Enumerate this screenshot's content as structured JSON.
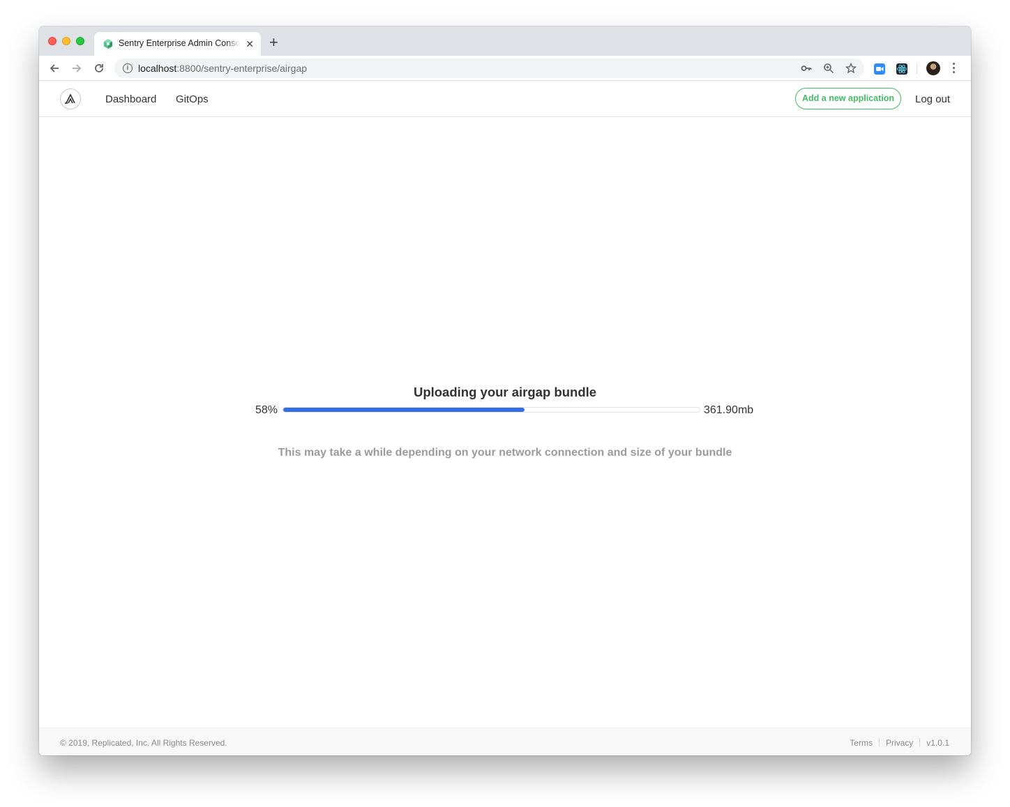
{
  "browser": {
    "tab_title": "Sentry Enterprise Admin Console",
    "tab_favicon": "replicated-cube-icon",
    "url_host": "localhost",
    "url_path": ":8800/sentry-enterprise/airgap",
    "toolbar_icons": [
      "back-icon",
      "forward-icon",
      "reload-icon",
      "info-icon",
      "key-icon",
      "zoom-icon",
      "star-icon",
      "zoom-extension-icon",
      "react-extension-icon",
      "profile-avatar",
      "menu-kebab-icon"
    ]
  },
  "header": {
    "logo": "sentry-logo-icon",
    "nav": [
      "Dashboard",
      "GitOps"
    ],
    "add_app_label": "Add a new application",
    "logout_label": "Log out"
  },
  "colors": {
    "accent_green": "#44bb66",
    "progress_blue": "#326de6",
    "muted_text": "#9b9b9b"
  },
  "upload": {
    "title": "Uploading your airgap bundle",
    "percent_label": "58%",
    "progress": 0.58,
    "size_label": "361.90mb",
    "note": "This may take a while depending on your network connection and size of your bundle"
  },
  "footer": {
    "copyright": "© 2019, Replicated, Inc. All Rights Reserved.",
    "terms": "Terms",
    "privacy": "Privacy",
    "version": "v1.0.1"
  }
}
